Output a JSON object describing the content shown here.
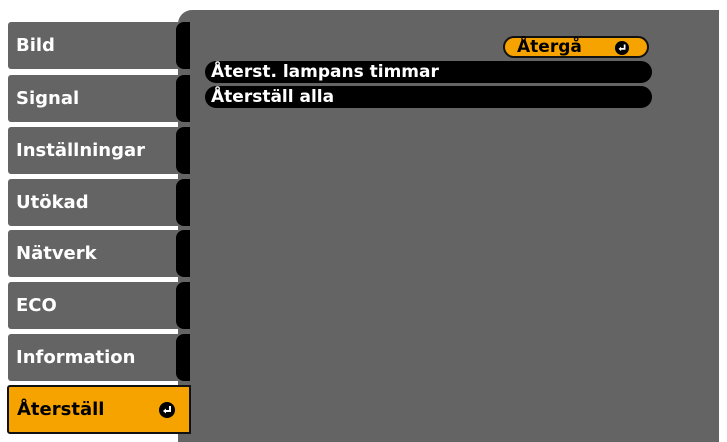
{
  "tabs": [
    {
      "label": "Bild"
    },
    {
      "label": "Signal"
    },
    {
      "label": "Inställningar"
    },
    {
      "label": "Utökad"
    },
    {
      "label": "Nätverk"
    },
    {
      "label": "ECO"
    },
    {
      "label": "Information"
    },
    {
      "label": "Återställ"
    }
  ],
  "selected_tab": "Återställ",
  "panel": {
    "back_label": "Återgå",
    "options": [
      {
        "label": "Återst. lampans timmar"
      },
      {
        "label": "Återställ alla"
      }
    ]
  },
  "colors": {
    "tab_bg": "#646464",
    "selected_bg": "#f6a300",
    "frame": "#000000"
  },
  "icons": {
    "enter": "enter-icon"
  }
}
